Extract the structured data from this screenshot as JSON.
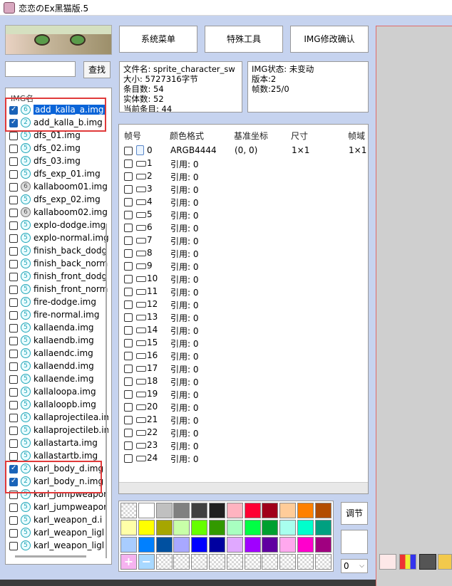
{
  "window": {
    "title": "恋恋のEx黑猫版.5"
  },
  "search": {
    "value": "",
    "button": "查找"
  },
  "img_list": {
    "header": "IMG名",
    "items": [
      {
        "name": "add_kalla_a.img",
        "checked": true,
        "ver": "6",
        "selected": true
      },
      {
        "name": "add_kalla_b.img",
        "checked": true,
        "ver": "2"
      },
      {
        "name": "dfs_01.img",
        "checked": false,
        "ver": "5"
      },
      {
        "name": "dfs_02.img",
        "checked": false,
        "ver": "5"
      },
      {
        "name": "dfs_03.img",
        "checked": false,
        "ver": "5"
      },
      {
        "name": "dfs_exp_01.img",
        "checked": false,
        "ver": "5"
      },
      {
        "name": "kallaboom01.img",
        "checked": false,
        "ver": "6",
        "gray": true
      },
      {
        "name": "dfs_exp_02.img",
        "checked": false,
        "ver": "5"
      },
      {
        "name": "kallaboom02.img",
        "checked": false,
        "ver": "6",
        "gray": true
      },
      {
        "name": "explo-dodge.img",
        "checked": false,
        "ver": "5"
      },
      {
        "name": "explo-normal.img",
        "checked": false,
        "ver": "5"
      },
      {
        "name": "finish_back_dodg",
        "checked": false,
        "ver": "5"
      },
      {
        "name": "finish_back_norm",
        "checked": false,
        "ver": "5"
      },
      {
        "name": "finish_front_dodg",
        "checked": false,
        "ver": "5"
      },
      {
        "name": "finish_front_norm",
        "checked": false,
        "ver": "5"
      },
      {
        "name": "fire-dodge.img",
        "checked": false,
        "ver": "5"
      },
      {
        "name": "fire-normal.img",
        "checked": false,
        "ver": "5"
      },
      {
        "name": "kallaenda.img",
        "checked": false,
        "ver": "5"
      },
      {
        "name": "kallaendb.img",
        "checked": false,
        "ver": "5"
      },
      {
        "name": "kallaendc.img",
        "checked": false,
        "ver": "5"
      },
      {
        "name": "kallaendd.img",
        "checked": false,
        "ver": "5"
      },
      {
        "name": "kallaende.img",
        "checked": false,
        "ver": "5"
      },
      {
        "name": "kallaloopa.img",
        "checked": false,
        "ver": "5"
      },
      {
        "name": "kallaloopb.img",
        "checked": false,
        "ver": "5"
      },
      {
        "name": "kallaprojectilea.im",
        "checked": false,
        "ver": "5"
      },
      {
        "name": "kallaprojectileb.in",
        "checked": false,
        "ver": "5"
      },
      {
        "name": "kallastarta.img",
        "checked": false,
        "ver": "5"
      },
      {
        "name": "kallastartb.img",
        "checked": false,
        "ver": "5"
      },
      {
        "name": "karl_body_d.img",
        "checked": true,
        "ver": "2"
      },
      {
        "name": "karl_body_n.img",
        "checked": true,
        "ver": "2"
      },
      {
        "name": "karl_jumpweapor",
        "checked": false,
        "ver": "5"
      },
      {
        "name": "karl_jumpweapor",
        "checked": false,
        "ver": "5"
      },
      {
        "name": "karl_weapon_d.i",
        "checked": false,
        "ver": "5"
      },
      {
        "name": "karl_weapon_ligl",
        "checked": false,
        "ver": "5"
      },
      {
        "name": "karl_weapon_ligl",
        "checked": false,
        "ver": "5"
      }
    ]
  },
  "toolbar": {
    "system_menu": "系统菜单",
    "special_tools": "特殊工具",
    "img_confirm": "IMG修改确认"
  },
  "file_info": {
    "filename": "文件名: sprite_character_sw",
    "size": "大小: 5727316字节",
    "entries": "条目数: 54",
    "entities": "实体数: 52",
    "current": "当前条目: 44"
  },
  "img_status": {
    "status": "IMG状态: 未变动",
    "version": "版本:2",
    "frames": "帧数:25/0"
  },
  "frames": {
    "headers": [
      "帧号",
      "颜色格式",
      "基准坐标",
      "尺寸",
      "帧域"
    ],
    "first": {
      "num": "0",
      "format": "ARGB4444",
      "coord": "(0, 0)",
      "size": "1×1",
      "domain": "1×1"
    },
    "rows": [
      {
        "num": "1",
        "ref": "引用: 0"
      },
      {
        "num": "2",
        "ref": "引用: 0"
      },
      {
        "num": "3",
        "ref": "引用: 0"
      },
      {
        "num": "4",
        "ref": "引用: 0"
      },
      {
        "num": "5",
        "ref": "引用: 0"
      },
      {
        "num": "6",
        "ref": "引用: 0"
      },
      {
        "num": "7",
        "ref": "引用: 0"
      },
      {
        "num": "8",
        "ref": "引用: 0"
      },
      {
        "num": "9",
        "ref": "引用: 0"
      },
      {
        "num": "10",
        "ref": "引用: 0"
      },
      {
        "num": "11",
        "ref": "引用: 0"
      },
      {
        "num": "12",
        "ref": "引用: 0"
      },
      {
        "num": "13",
        "ref": "引用: 0"
      },
      {
        "num": "14",
        "ref": "引用: 0"
      },
      {
        "num": "15",
        "ref": "引用: 0"
      },
      {
        "num": "16",
        "ref": "引用: 0"
      },
      {
        "num": "17",
        "ref": "引用: 0"
      },
      {
        "num": "18",
        "ref": "引用: 0"
      },
      {
        "num": "19",
        "ref": "引用: 0"
      },
      {
        "num": "20",
        "ref": "引用: 0"
      },
      {
        "num": "21",
        "ref": "引用: 0"
      },
      {
        "num": "22",
        "ref": "引用: 0"
      },
      {
        "num": "23",
        "ref": "引用: 0"
      },
      {
        "num": "24",
        "ref": "引用: 0"
      }
    ]
  },
  "palette": {
    "colors": [
      "checker",
      "#ffffff",
      "#c0c0c0",
      "#808080",
      "#404040",
      "#202020",
      "#ffb3c0",
      "#ff0033",
      "#a0001a",
      "#ffcc99",
      "#ff8000",
      "#b34d00",
      "#ffffa8",
      "#ffff00",
      "#a6a600",
      "#c8ffa8",
      "#66ff00",
      "#339900",
      "#a8ffc0",
      "#00ff44",
      "#00a030",
      "#a8ffee",
      "#00ffcc",
      "#00a080",
      "#a8ccff",
      "#0080ff",
      "#0050a0",
      "#a8a8ff",
      "#0000ff",
      "#0000a0",
      "#e0a8ff",
      "#a000ff",
      "#6000a0",
      "#ffa8ee",
      "#ff00cc",
      "#a00080",
      "add",
      "remove",
      "checker",
      "checker",
      "checker",
      "checker",
      "checker",
      "checker",
      "checker",
      "checker",
      "checker",
      "checker"
    ],
    "adjust_label": "调节",
    "number": "0"
  },
  "icons": {
    "app": "app-icon",
    "frame_image": "image-frame-icon",
    "frame_link": "link-frame-icon",
    "version_badge": "version-badge-icon",
    "palette_add": "plus-icon",
    "palette_remove": "minus-icon",
    "tool_pencil": "pencil-tool-icon",
    "tool_palette": "palette-tool-icon",
    "tool_film": "film-tool-icon",
    "tool_hand": "hand-tool-icon"
  }
}
